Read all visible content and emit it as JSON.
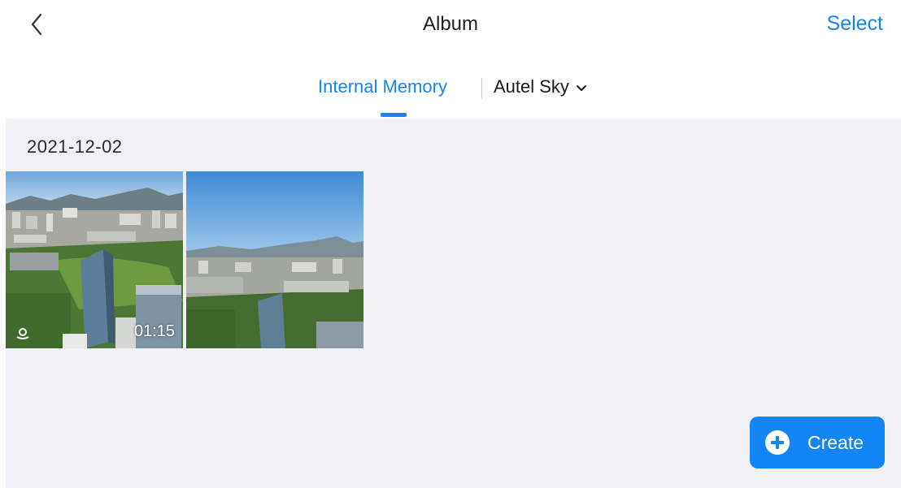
{
  "header": {
    "back_icon": "chevron-left-icon",
    "title": "Album",
    "select_label": "Select"
  },
  "tabs": {
    "internal_memory": "Internal Memory",
    "autel_sky": "Autel Sky",
    "dropdown_icon": "chevron-down-icon",
    "active": "Internal Memory"
  },
  "album": {
    "date": "2021-12-02",
    "items": [
      {
        "type": "video",
        "duration": "01:15",
        "badge_icon": "panorama-orbit-icon"
      },
      {
        "type": "photo"
      }
    ]
  },
  "create": {
    "label": "Create",
    "icon": "plus-circle-icon"
  },
  "colors": {
    "accent": "#1485f4",
    "background": "#f1f1f5"
  }
}
